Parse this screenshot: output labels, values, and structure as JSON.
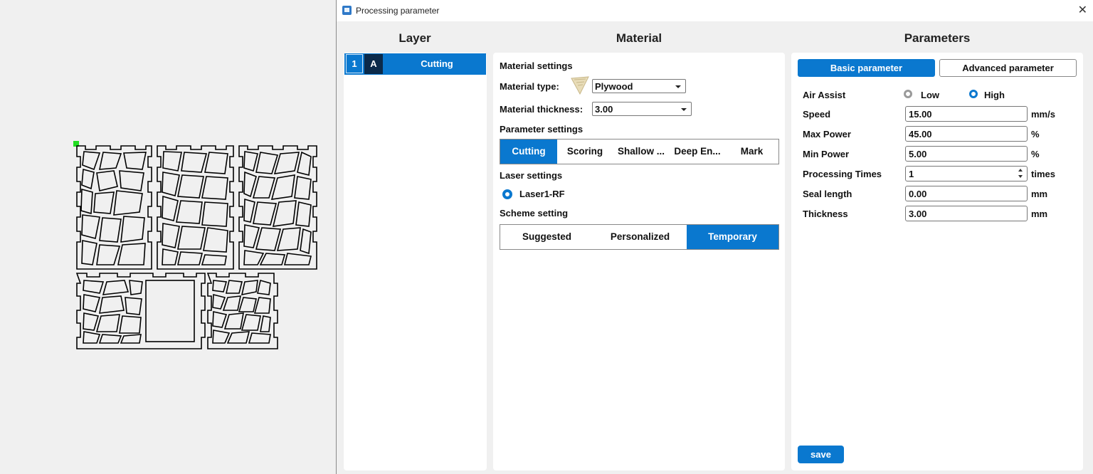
{
  "dialog": {
    "title": "Processing parameter",
    "close_glyph": "✕"
  },
  "columns": {
    "layer": "Layer",
    "material": "Material",
    "parameters": "Parameters"
  },
  "layer_row": {
    "number": "1",
    "letter": "A",
    "mode": "Cutting"
  },
  "material": {
    "section_material": "Material settings",
    "type_label": "Material type:",
    "type_value": "Plywood",
    "thickness_label": "Material thickness:",
    "thickness_value": "3.00",
    "section_parameter": "Parameter settings",
    "modes": [
      "Cutting",
      "Scoring",
      "Shallow ...",
      "Deep En...",
      "Mark"
    ],
    "active_mode": "Cutting",
    "section_laser": "Laser settings",
    "laser": "Laser1-RF",
    "section_scheme": "Scheme setting",
    "schemes": [
      "Suggested",
      "Personalized",
      "Temporary"
    ],
    "active_scheme": "Temporary"
  },
  "parameters": {
    "tabs": [
      "Basic parameter",
      "Advanced parameter"
    ],
    "active_tab": "Basic parameter",
    "air_assist": {
      "label": "Air Assist",
      "options": [
        "Low",
        "High"
      ],
      "selected": "High"
    },
    "fields": [
      {
        "label": "Speed",
        "value": "15.00",
        "unit": "mm/s"
      },
      {
        "label": "Max Power",
        "value": "45.00",
        "unit": "%"
      },
      {
        "label": "Min Power",
        "value": "5.00",
        "unit": "%"
      },
      {
        "label": "Processing Times",
        "value": "1",
        "unit": "times"
      },
      {
        "label": "Seal length",
        "value": "0.00",
        "unit": "mm"
      },
      {
        "label": "Thickness",
        "value": "3.00",
        "unit": "mm"
      }
    ],
    "save_label": "save"
  },
  "colors": {
    "accent": "#0a78cf",
    "dark_layer": "#0b2a4a",
    "selection_handle": "#22dd22"
  }
}
